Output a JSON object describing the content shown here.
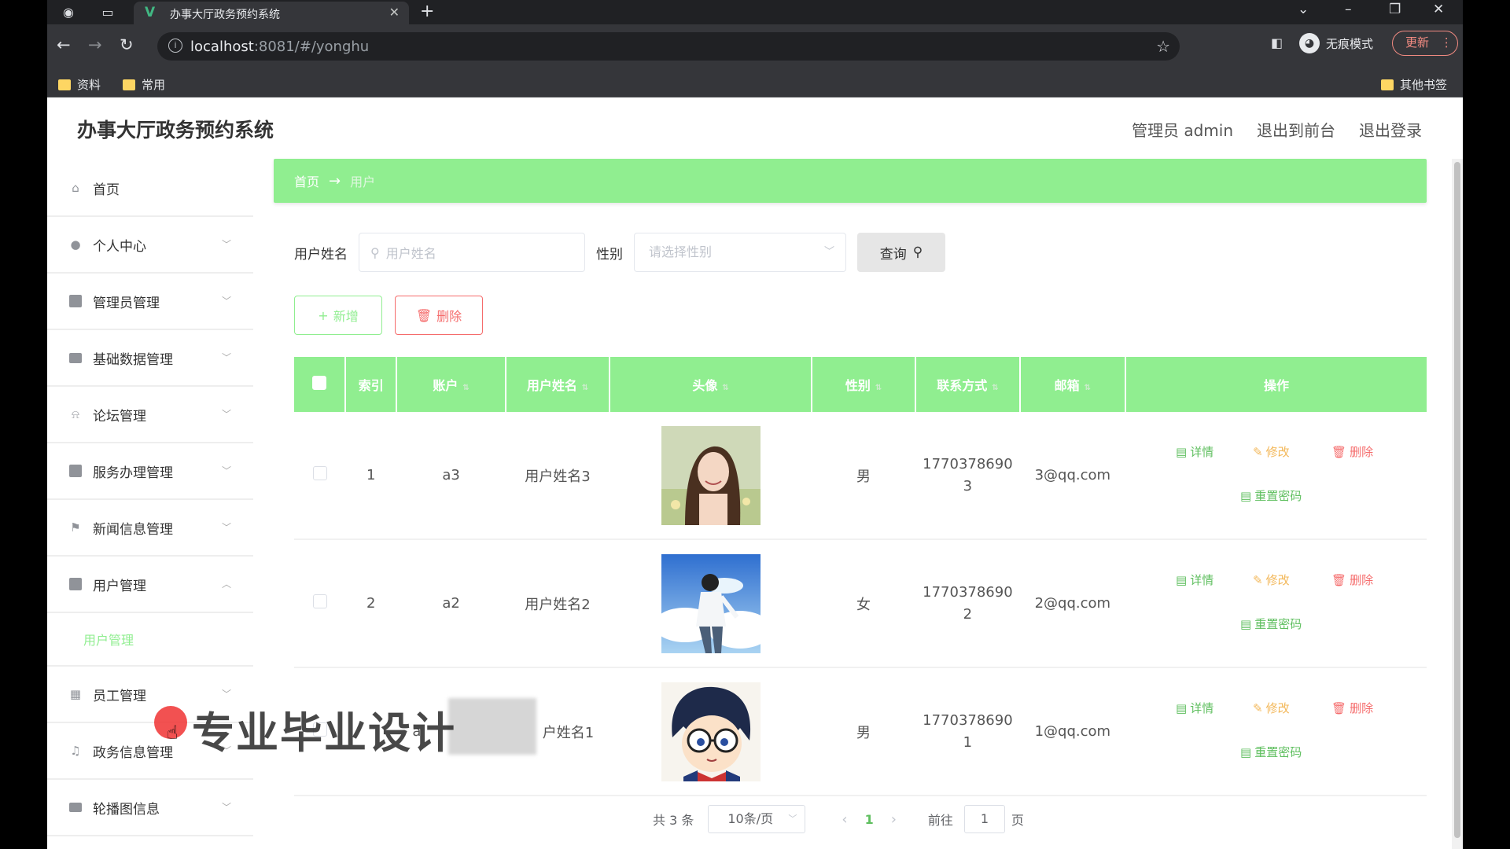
{
  "browser": {
    "tab_title": "办事大厅政务预约系统",
    "url_host": "localhost",
    "url_rest": ":8081/#/yonghu",
    "incognito_label": "无痕模式",
    "update_label": "更新",
    "bookmarks": [
      "资料",
      "常用"
    ],
    "other_bookmarks": "其他书签"
  },
  "header": {
    "title": "办事大厅政务预约系统",
    "links": [
      "管理员 admin",
      "退出到前台",
      "退出登录"
    ]
  },
  "sidebar": {
    "items": [
      {
        "label": "首页",
        "icon": "home-icon"
      },
      {
        "label": "个人中心",
        "icon": "user-icon"
      },
      {
        "label": "管理员管理",
        "icon": "clipboard-icon"
      },
      {
        "label": "基础数据管理",
        "icon": "monitor-icon"
      },
      {
        "label": "论坛管理",
        "icon": "bell-icon"
      },
      {
        "label": "服务办理管理",
        "icon": "clipboard-check-icon"
      },
      {
        "label": "新闻信息管理",
        "icon": "flag-icon"
      },
      {
        "label": "用户管理",
        "icon": "document-icon"
      },
      {
        "label": "员工管理",
        "icon": "grid-icon"
      },
      {
        "label": "政务信息管理",
        "icon": "microphone-icon"
      },
      {
        "label": "轮播图信息",
        "icon": "printer-icon"
      }
    ],
    "submenu_active": "用户管理"
  },
  "breadcrumb": {
    "home": "首页",
    "arrow": "→",
    "current": "用户"
  },
  "search": {
    "name_label": "用户姓名",
    "name_placeholder": "用户姓名",
    "gender_label": "性别",
    "gender_placeholder": "请选择性别",
    "query_label": "查询"
  },
  "actions": {
    "add_label": "新增",
    "delete_label": "删除"
  },
  "table": {
    "headers": [
      "索引",
      "账户",
      "用户姓名",
      "头像",
      "性别",
      "联系方式",
      "邮箱",
      "操作"
    ],
    "rows": [
      {
        "index": "1",
        "account": "a3",
        "name": "用户姓名3",
        "avatar": "photo-girl-flowers",
        "gender": "男",
        "phone_1": "1770378690",
        "phone_2": "3",
        "email": "3@qq.com"
      },
      {
        "index": "2",
        "account": "a2",
        "name": "用户姓名2",
        "avatar": "illustration-boy-sky",
        "gender": "女",
        "phone_1": "1770378690",
        "phone_2": "2",
        "email": "2@qq.com"
      },
      {
        "index": "3",
        "account": "a",
        "name": "户姓名1",
        "avatar": "cartoon-detective-conan",
        "gender": "男",
        "phone_1": "1770378690",
        "phone_2": "1",
        "email": "1@qq.com"
      }
    ],
    "ops": {
      "detail": "详情",
      "edit": "修改",
      "delete": "删除",
      "reset": "重置密码"
    }
  },
  "pagination": {
    "total": "共 3 条",
    "page_size": "10条/页",
    "current_page": "1",
    "goto_label": "前往",
    "goto_value": "1",
    "page_suffix": "页"
  },
  "overlay": {
    "watermark": "专业毕业设计"
  },
  "colors": {
    "accent": "#90ee90",
    "danger": "#f56c6c",
    "warning": "#f3b85a",
    "chrome_dark": "#202124"
  }
}
